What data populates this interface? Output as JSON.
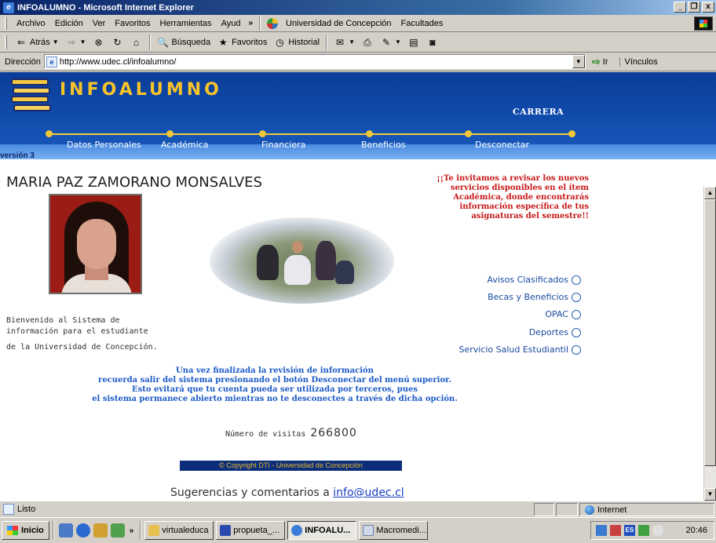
{
  "window": {
    "title": "INFOALUMNO - Microsoft Internet Explorer",
    "buttons": [
      "_",
      "❒",
      "x"
    ]
  },
  "menubar": {
    "items": [
      "Archivo",
      "Edición",
      "Ver",
      "Favoritos",
      "Herramientas",
      "Ayud"
    ],
    "chevron": "»",
    "links": [
      "Universidad de Concepción",
      "Facultades"
    ]
  },
  "toolbar": {
    "back": "Atrás",
    "search": "Búsqueda",
    "favorites": "Favoritos",
    "history": "Historial"
  },
  "addressbar": {
    "label": "Dirección",
    "url": "http://www.udec.cl/infoalumno/",
    "go": "Ir",
    "links": "Vínculos"
  },
  "site": {
    "title": "INFOALUMNO",
    "section": "CARRERA",
    "version": "versión 3",
    "nav": [
      "Datos Personales",
      "Académica",
      "Financiera",
      "Beneficios",
      "Desconectar"
    ]
  },
  "student": {
    "name": "MARIA PAZ ZAMORANO MONSALVES"
  },
  "promo": {
    "text": "¡¡Te invitamos a revisar los nuevos servicios disponibles en el ítem Académica, donde encontrarás información específica de tus asignaturas del semestre!!"
  },
  "quicklinks": [
    "Avisos Clasificados",
    "Becas y Beneficios",
    "OPAC",
    "Deportes",
    "Servicio Salud Estudiantil"
  ],
  "welcome": {
    "line1": "Bienvenido al Sistema de",
    "line2": "información para el estudiante",
    "line3": "de la Universidad de Concepción."
  },
  "notice": {
    "line1": "Una vez finalizada la revisión de información",
    "line2": "recuerda salir del sistema presionando el botón Desconectar del menú superior.",
    "line3": "Esto evitará que tu cuenta pueda ser utilizada por terceros, pues",
    "line4": "el sistema permanece abierto mientras no te desconectes a través de dicha opción."
  },
  "visits": {
    "label": "Número de visitas",
    "count": "266800"
  },
  "footer": {
    "copyright": "© Copyright DTI - Universidad de Concepción",
    "suggest_label": "Sugerencias y comentarios a",
    "email": "info@udec.cl"
  },
  "statusbar": {
    "status": "Listo",
    "zone": "Internet"
  },
  "taskbar": {
    "start": "Inicio",
    "chevron": "»",
    "tasks": [
      "virtualeduca",
      "propueta_...",
      "INFOALU...",
      "Macromedi..."
    ],
    "tray_lang": "ES",
    "clock": "20:46"
  }
}
